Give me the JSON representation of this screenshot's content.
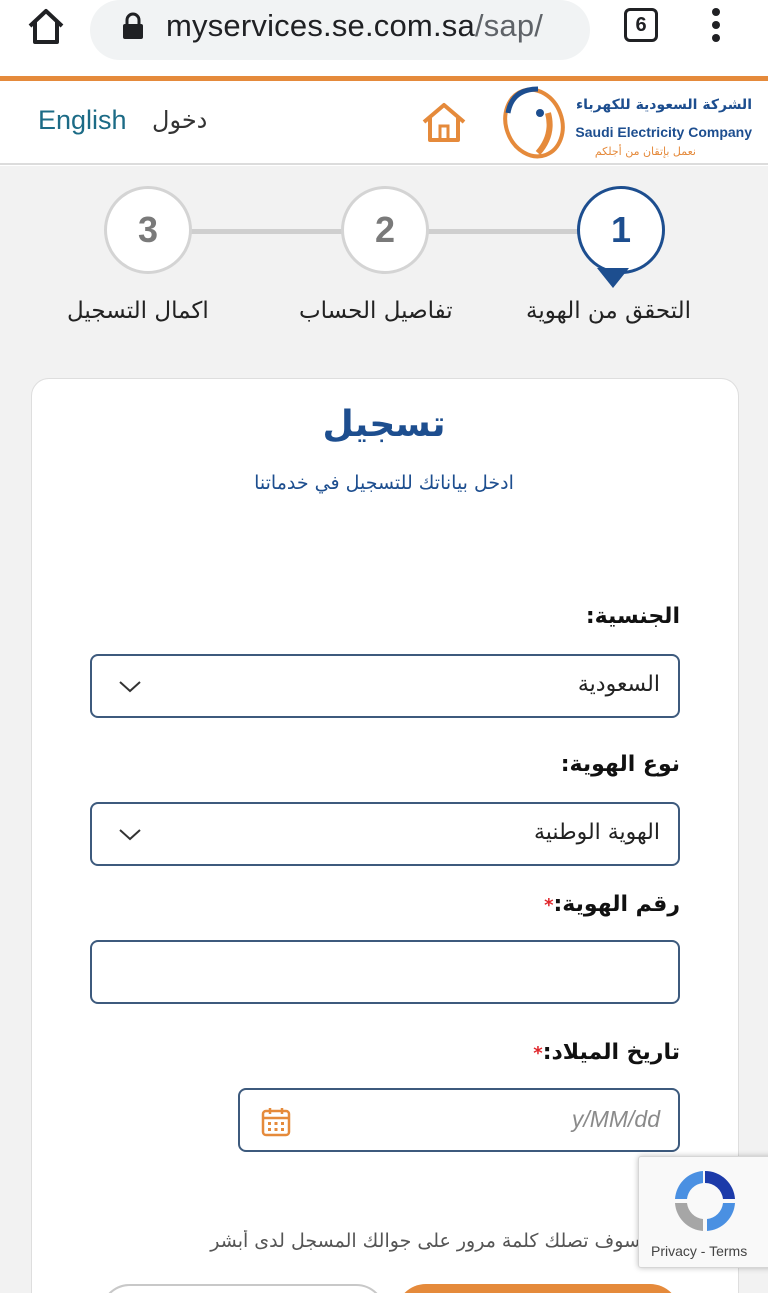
{
  "browser": {
    "url_host": "myservices.se.com.sa",
    "url_path": "/sap/",
    "tab_count": "6"
  },
  "header": {
    "language_link": "English",
    "login_link": "دخول",
    "logo": {
      "name_ar": "الشركة السعودية للكهرباء",
      "name_en": "Saudi Electricity Company",
      "tagline": "نعمل بإتقان من أجلكم"
    }
  },
  "stepper": {
    "steps": [
      {
        "number": "1",
        "label": "التحقق من الهوية",
        "active": true
      },
      {
        "number": "2",
        "label": "تفاصيل الحساب",
        "active": false
      },
      {
        "number": "3",
        "label": "اكمال التسجيل",
        "active": false
      }
    ]
  },
  "form": {
    "title": "تسجيل",
    "subtitle": "ادخل بياناتك للتسجيل في خدماتنا",
    "nationality": {
      "label": "الجنسية:",
      "value": "السعودية"
    },
    "id_type": {
      "label": "نوع الهوية:",
      "value": "الهوية الوطنية"
    },
    "id_number": {
      "label": "رقم الهوية:",
      "required_mark": "*",
      "value": ""
    },
    "birth_date": {
      "label": "تاريخ الميلاد:",
      "required_mark": "*",
      "placeholder": "y/MM/dd"
    },
    "note": "سوف تصلك كلمة مرور على جوالك المسجل لدى أبشر"
  },
  "recaptcha": {
    "privacy": "Privacy",
    "separator": " - ",
    "terms": "Terms"
  },
  "colors": {
    "brand_blue": "#1d4e8f",
    "brand_orange": "#e58a3b",
    "required_red": "#e0262b"
  }
}
